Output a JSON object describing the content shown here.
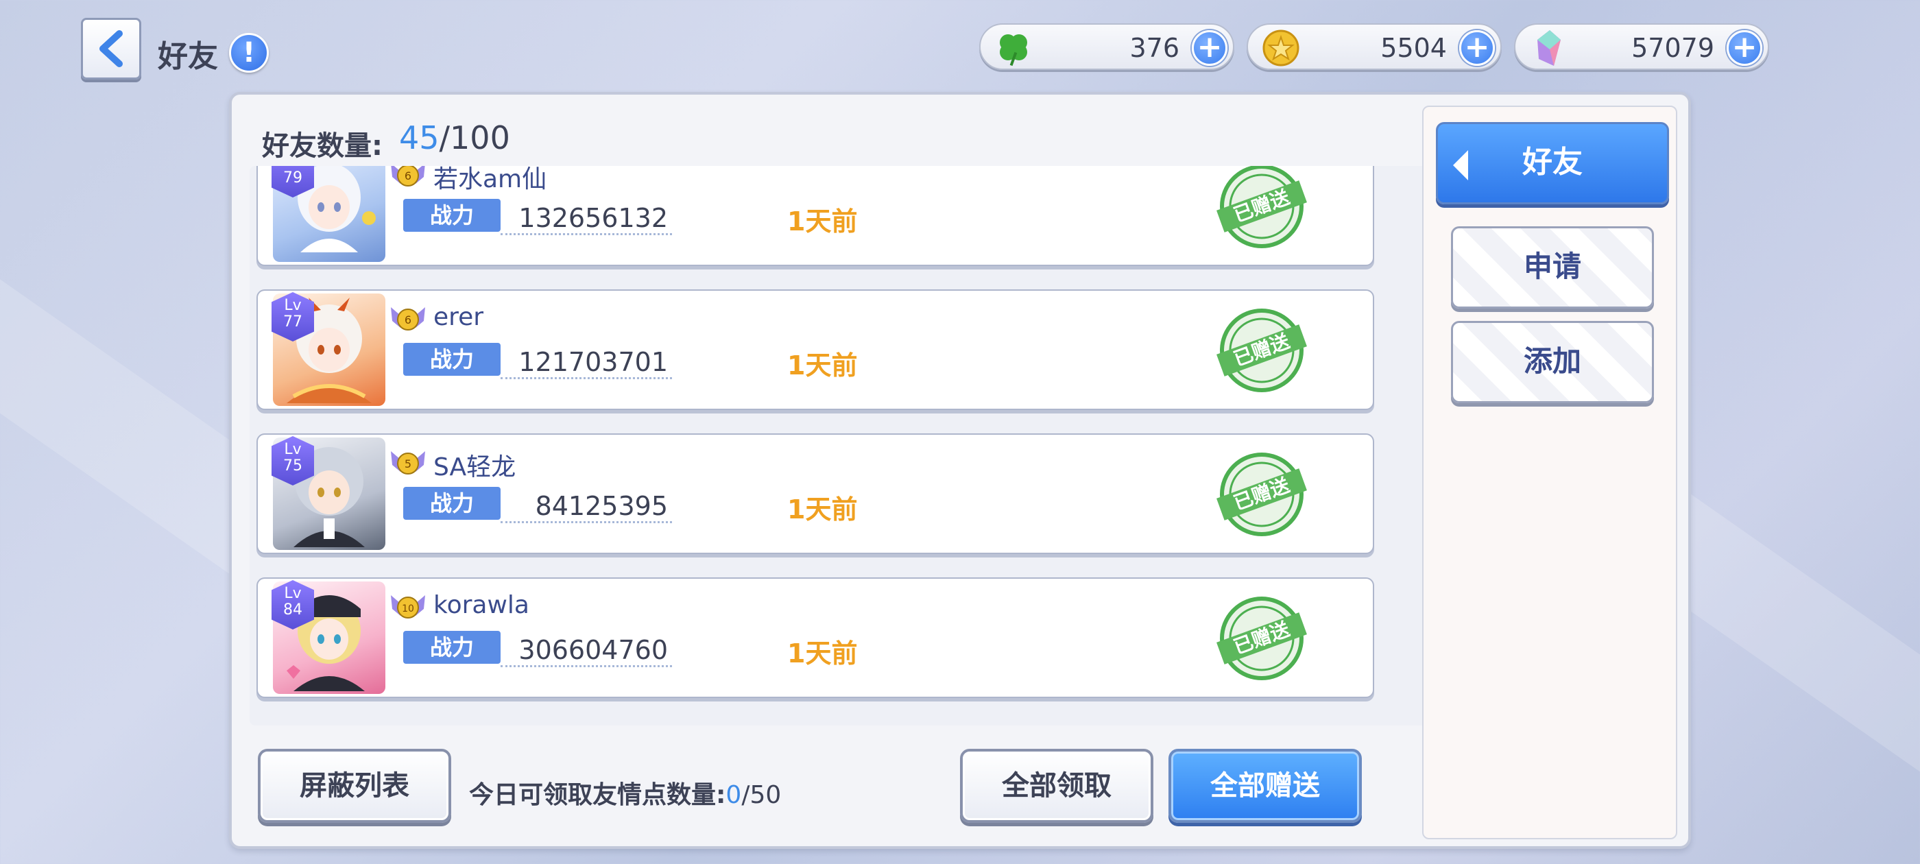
{
  "header": {
    "title": "好友",
    "info_icon": "info-icon",
    "back_icon": "chevron-left-icon"
  },
  "currencies": [
    {
      "name": "clover",
      "icon": "clover-icon",
      "value": "376"
    },
    {
      "name": "coin",
      "icon": "star-coin-icon",
      "value": "5504"
    },
    {
      "name": "gem",
      "icon": "crystal-icon",
      "value": "57079"
    }
  ],
  "friend_count": {
    "label": "好友数量:",
    "current": "45",
    "max": "/100"
  },
  "friends": [
    {
      "level_label": "Lv",
      "level": "79",
      "rank": "6",
      "name": "若水am仙",
      "power_label": "战力",
      "power": "132656132",
      "last_login": "1天前",
      "status": "已赠送"
    },
    {
      "level_label": "Lv",
      "level": "77",
      "rank": "6",
      "name": "erer",
      "power_label": "战力",
      "power": "121703701",
      "last_login": "1天前",
      "status": "已赠送"
    },
    {
      "level_label": "Lv",
      "level": "75",
      "rank": "5",
      "name": "SA轻龙",
      "power_label": "战力",
      "power": "84125395",
      "last_login": "1天前",
      "status": "已赠送"
    },
    {
      "level_label": "Lv",
      "level": "84",
      "rank": "10",
      "name": "korawla",
      "power_label": "战力",
      "power": "306604760",
      "last_login": "1天前",
      "status": "已赠送"
    }
  ],
  "footer": {
    "block_list_label": "屏蔽列表",
    "daily_label": "今日可领取友情点数量:",
    "daily_current": "0",
    "daily_max": "/50",
    "claim_all_label": "全部领取",
    "send_all_label": "全部赠送"
  },
  "sidebar": {
    "tabs": [
      {
        "label": "好友",
        "active": true
      },
      {
        "label": "申请",
        "active": false
      },
      {
        "label": "添加",
        "active": false
      }
    ]
  },
  "colors": {
    "accent_blue": "#2e7ff0",
    "time_orange": "#f0a020",
    "stamp_green": "#4caf50"
  }
}
